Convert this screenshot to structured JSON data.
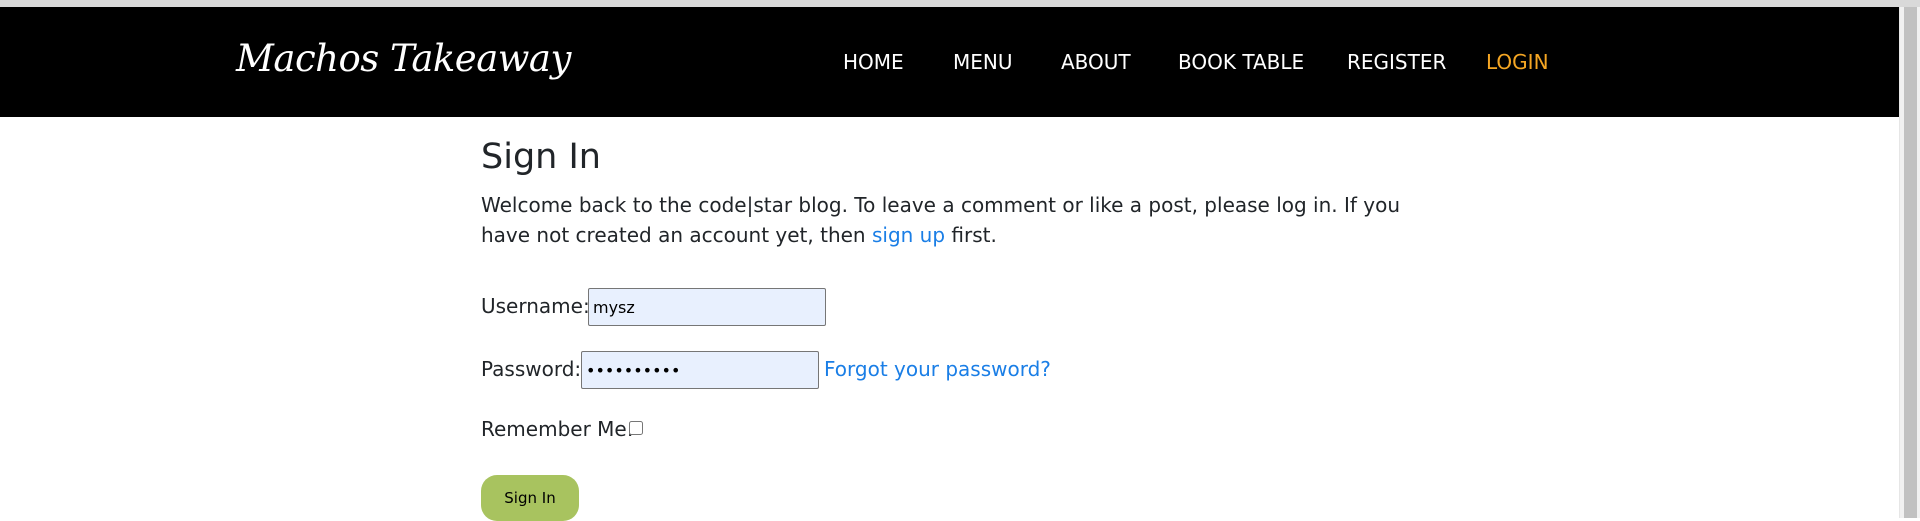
{
  "brand": "Machos Takeaway",
  "nav": {
    "home": "HOME",
    "menu": "MENU",
    "about": "ABOUT",
    "book_table": "BOOK TABLE",
    "register": "REGISTER",
    "login": "LOGIN"
  },
  "colors": {
    "navbar_bg": "#000000",
    "active_link": "#f5a623",
    "link": "#1a7ee6",
    "button": "#a8c35f",
    "autofill_bg": "#e8f0fe"
  },
  "signin": {
    "title": "Sign In",
    "intro_before": "Welcome back to the code|star blog. To leave a comment or like a post, please log in. If you have not created an account yet, then ",
    "signup_link": "sign up",
    "intro_after": " first.",
    "username_label": "Username:",
    "username_value": "mysz",
    "password_label": "Password:",
    "password_value": "mypassword",
    "forgot_link": "Forgot your password?",
    "remember_label": "Remember Me:",
    "remember_checked": false,
    "submit_label": "Sign In"
  }
}
